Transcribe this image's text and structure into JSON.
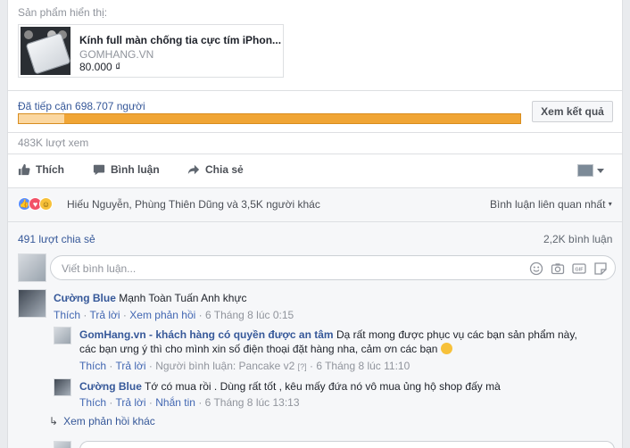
{
  "promoted": {
    "section_label": "Sản phẩm hiển thị:",
    "product": {
      "title": "Kính full màn chống tia cực tím iPhon...",
      "domain": "GOMHANG.VN",
      "price": "80.000 ₫"
    }
  },
  "insights": {
    "reach_text": "Đã tiếp cận 698.707 người",
    "reach_progress_fraction": 0.09,
    "results_button": "Xem kết quả",
    "views_text": "483K lượt xem"
  },
  "actions": {
    "like": "Thích",
    "comment": "Bình luận",
    "share": "Chia sẻ"
  },
  "reactions": {
    "summary": "Hiếu Nguyễn, Phùng Thiên Dũng và 3,5K người khác",
    "sort_label": "Bình luận liên quan nhất"
  },
  "stats": {
    "shares": "491 lượt chia sẻ",
    "comments": "2,2K bình luận"
  },
  "composer": {
    "placeholder": "Viết bình luận..."
  },
  "comments": [
    {
      "author": "Cường Blue",
      "text": "Mạnh Toàn Tuấn Anh khực",
      "like": "Thích",
      "reply": "Trả lời",
      "view_replies": "Xem phản hồi",
      "time": "6 Tháng 8 lúc 0:15"
    },
    {
      "author": "GomHang.vn - khách hàng có quyền được an tâm",
      "text": "Dạ rất mong được phục vụ các bạn sản phẩm này,",
      "text2": "các bạn ưng ý thì cho mình xin số điện thoại đặt hàng nha, cảm ơn các bạn",
      "like": "Thích",
      "reply": "Trả lời",
      "commenter": "Người bình luận: Pancake v2",
      "edit_mark": "[?]",
      "time": "6 Tháng 8 lúc 11:10"
    },
    {
      "author": "Cường Blue",
      "text": "Tớ có mua rồi . Dùng rất tốt , kêu mấy đứa nó vô mua ủng hộ shop đấy mà",
      "like": "Thích",
      "reply": "Trả lời",
      "message": "Nhắn tin",
      "time": "6 Tháng 8 lúc 13:13"
    }
  ],
  "more_replies": "Xem phản hồi khác"
}
